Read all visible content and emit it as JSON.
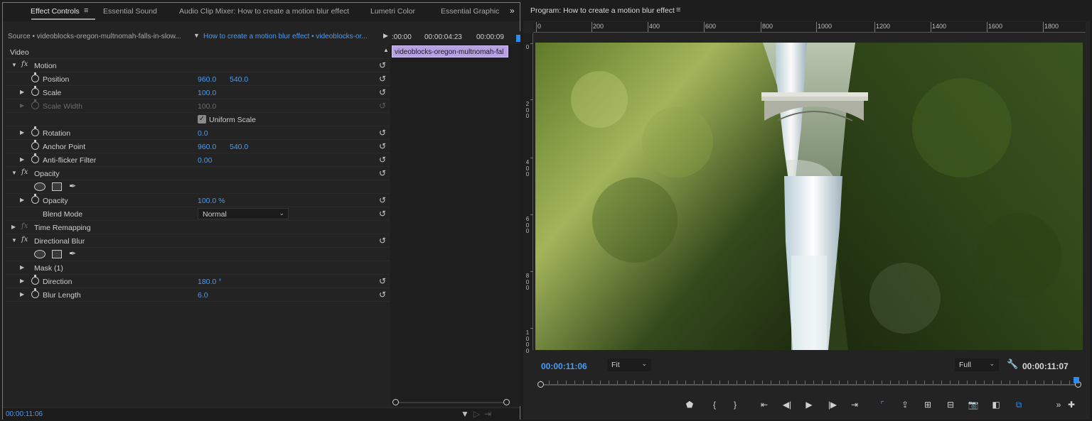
{
  "effect_controls": {
    "tabs": [
      {
        "label": "Effect Controls"
      },
      {
        "label": "Essential Sound"
      },
      {
        "label": "Audio Clip Mixer: How to create a motion blur effect"
      },
      {
        "label": "Lumetri Color"
      },
      {
        "label": "Essential Graphic"
      }
    ],
    "menu_icon": "≡",
    "overflow_icon": "»",
    "source_label": "Source • videoblocks-oregon-multnomah-falls-in-slow...",
    "sequence_label": "How to create a motion blur effect • videoblocks-or...",
    "section_video": "Video",
    "properties": {
      "motion": "Motion",
      "position": "Position",
      "position_x": "960.0",
      "position_y": "540.0",
      "scale": "Scale",
      "scale_value": "100.0",
      "scale_width": "Scale Width",
      "scale_width_value": "100.0",
      "uniform_scale": "Uniform Scale",
      "rotation": "Rotation",
      "rotation_value": "0.0",
      "anchor_point": "Anchor Point",
      "anchor_x": "960.0",
      "anchor_y": "540.0",
      "anti_flicker": "Anti-flicker Filter",
      "anti_flicker_value": "0.00",
      "opacity": "Opacity",
      "opacity_prop": "Opacity",
      "opacity_value": "100.0 %",
      "blend_mode": "Blend Mode",
      "blend_value": "Normal",
      "time_remapping": "Time Remapping",
      "directional_blur": "Directional Blur",
      "mask": "Mask (1)",
      "direction": "Direction",
      "direction_value": "180.0 °",
      "blur_length": "Blur Length",
      "blur_length_value": "6.0"
    },
    "fx_glyph": "fx",
    "mini_timeline": {
      "times": [
        ":00:00",
        "00:00:04:23",
        "00:00:09"
      ],
      "clip_name": "videoblocks-oregon-multnomah-fal"
    },
    "timecode": "00:00:11:06"
  },
  "program": {
    "title": "Program: How to create a motion blur effect",
    "menu_icon": "≡",
    "ruler_labels": [
      "0",
      "200",
      "400",
      "600",
      "800",
      "1000",
      "1200",
      "1400",
      "1600",
      "1800"
    ],
    "v_ruler_labels": [
      "0",
      "200",
      "400",
      "600",
      "800",
      "1000"
    ],
    "timecode": "00:00:11:06",
    "fit": "Fit",
    "resolution": "Full",
    "duration": "00:00:11:07",
    "transport_icons": [
      "marker-icon",
      "mark-in-icon",
      "mark-out-icon",
      "go-to-in-icon",
      "step-back-icon",
      "play-icon",
      "step-forward-icon",
      "go-to-out-icon",
      "lift-icon",
      "extract-icon",
      "insert-icon",
      "overwrite-icon",
      "export-frame-icon",
      "comparison-view-icon",
      "vr-icon",
      "more-icon",
      "add-button-icon"
    ]
  },
  "colors": {
    "accent": "#2d8ceb",
    "value_blue": "#4b9bf0",
    "clip": "#b7a1e4"
  }
}
